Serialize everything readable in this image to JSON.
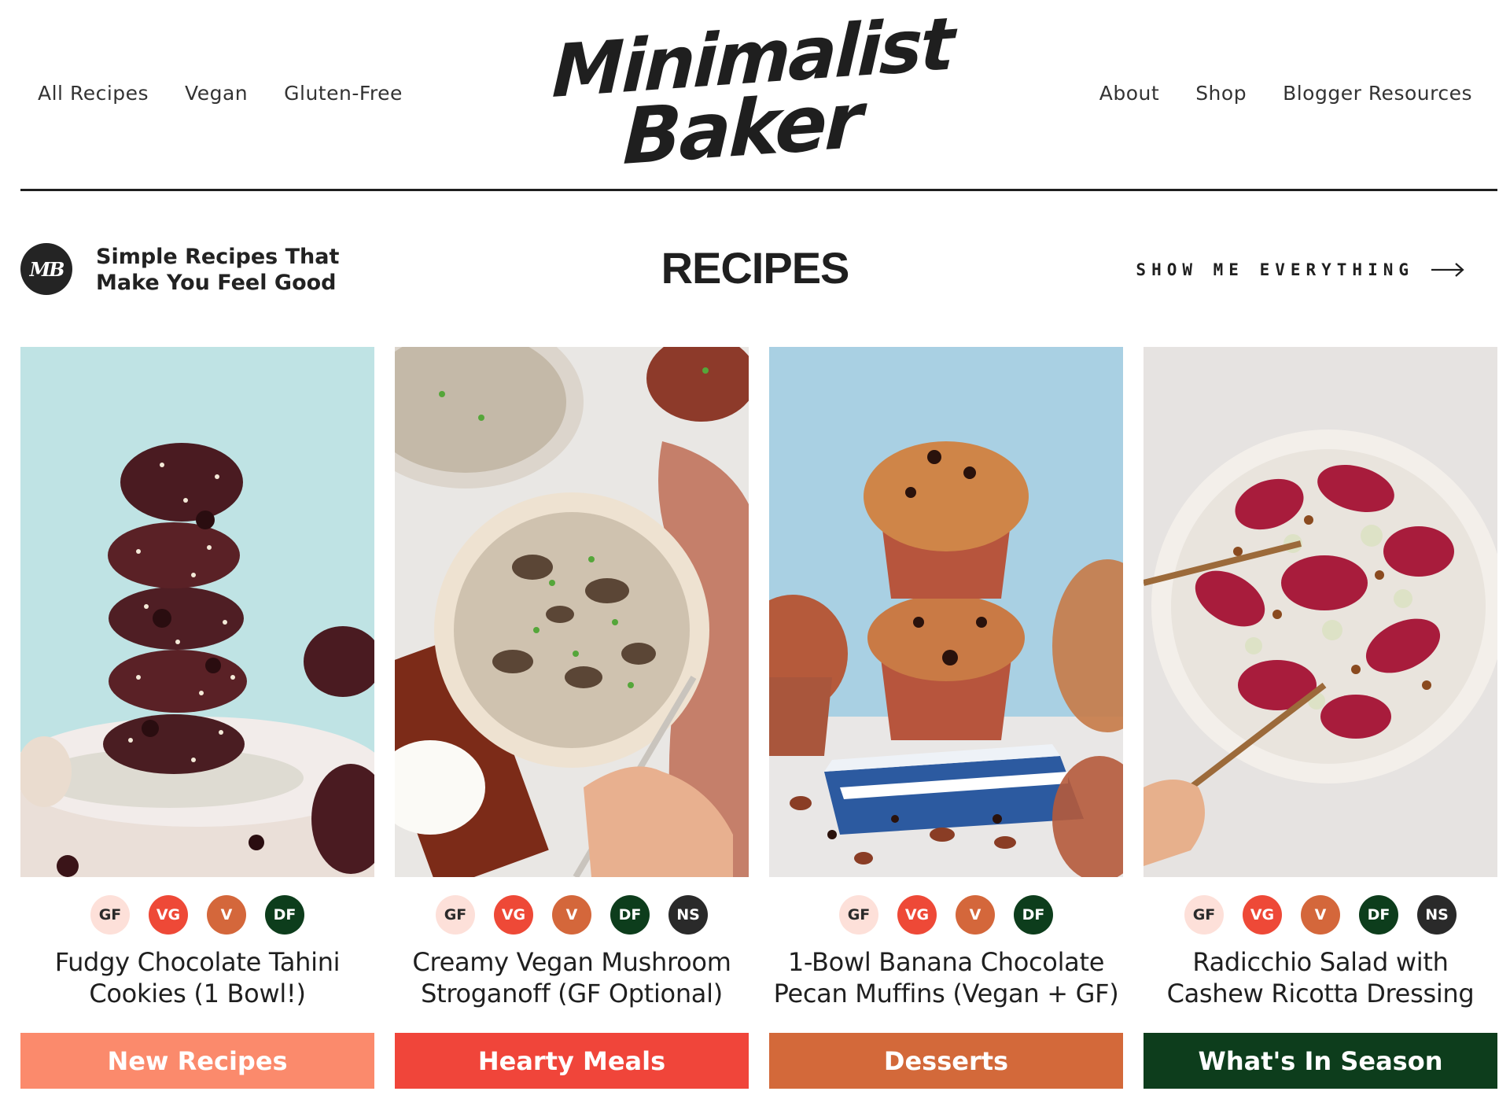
{
  "colors": {
    "text": "#1f1f1f",
    "gf": "#fde0d9",
    "vg": "#ee4937",
    "v": "#d4673b",
    "df": "#0d3d1c",
    "ns": "#2a2a2a",
    "btn_new": "#fb8a6c",
    "btn_hearty": "#f0453a",
    "btn_desserts": "#d3693a",
    "btn_season": "#0d3d1c"
  },
  "nav_left": [
    "All Recipes",
    "Vegan",
    "Gluten-Free"
  ],
  "nav_right": [
    "About",
    "Shop",
    "Blogger Resources"
  ],
  "logo": {
    "line1": "Minimalist",
    "line2": "Baker"
  },
  "section": {
    "badge": "MB",
    "tagline_line1": "Simple Recipes That",
    "tagline_line2": "Make You Feel Good",
    "title": "RECIPES",
    "show_all": "SHOW ME EVERYTHING",
    "arrow_icon": "arrow-right-icon"
  },
  "cards": [
    {
      "image": "chocolate-tahini-cookies-photo",
      "badges": [
        "GF",
        "VG",
        "V",
        "DF"
      ],
      "title_line1": "Fudgy Chocolate Tahini",
      "title_line2": "Cookies (1 Bowl!)",
      "button": "New Recipes"
    },
    {
      "image": "mushroom-stroganoff-photo",
      "badges": [
        "GF",
        "VG",
        "V",
        "DF",
        "NS"
      ],
      "title_line1": "Creamy Vegan Mushroom",
      "title_line2": "Stroganoff (GF Optional)",
      "button": "Hearty Meals"
    },
    {
      "image": "banana-chocolate-muffins-photo",
      "badges": [
        "GF",
        "VG",
        "V",
        "DF"
      ],
      "title_line1": "1-Bowl Banana Chocolate",
      "title_line2": "Pecan Muffins (Vegan + GF)",
      "button": "Desserts"
    },
    {
      "image": "radicchio-salad-photo",
      "badges": [
        "GF",
        "VG",
        "V",
        "DF",
        "NS"
      ],
      "title_line1": "Radicchio Salad with",
      "title_line2": "Cashew Ricotta Dressing",
      "button": "What's In Season"
    }
  ]
}
